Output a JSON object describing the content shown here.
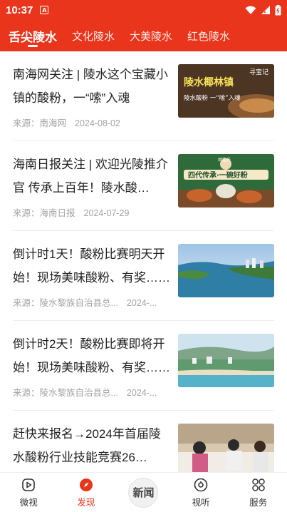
{
  "status": {
    "time": "10:37",
    "notif_letter": "A"
  },
  "tabs": [
    {
      "label": "舌尖陵水"
    },
    {
      "label": "文化陵水"
    },
    {
      "label": "大美陵水"
    },
    {
      "label": "红色陵水"
    }
  ],
  "articles": [
    {
      "title": "南海网关注 | 陵水这个宝藏小镇的酸粉，一“嗦”入魂",
      "source": "来源：南海网",
      "date": "2024-08-02",
      "thumb_text_1": "陵水椰林镇",
      "thumb_text_2": "陵水酸粉 一“嗦”入魂",
      "thumb_text_3": "寻宝记"
    },
    {
      "title": "海南日报关注 | 欢迎光陵推介官 传承上百年！陵水酸粉……",
      "source": "来源：海南日报",
      "date": "2024-07-29",
      "thumb_text_1": "四代传承·一碗好粉",
      "thumb_text_2": "胡佳光"
    },
    {
      "title": "倒计时1天！酸粉比赛明天开始！现场美味酸粉、有奖……",
      "source": "来源：陵水黎族自治县总...",
      "date": "2024-..."
    },
    {
      "title": "倒计时2天！酸粉比赛即将开始！现场美味酸粉、有奖……",
      "source": "来源：陵水黎族自治县总...",
      "date": "2024-..."
    },
    {
      "title": "赶快来报名→2024年首届陵水酸粉行业技能竞赛26日……",
      "source": "",
      "date": ""
    }
  ],
  "bottom_nav": [
    {
      "label": "微视",
      "icon": "play-circle-icon"
    },
    {
      "label": "发现",
      "icon": "compass-icon"
    },
    {
      "label": "新闻",
      "icon": "news-logo-icon"
    },
    {
      "label": "视听",
      "icon": "target-icon"
    },
    {
      "label": "服务",
      "icon": "grid-icon"
    }
  ],
  "colors": {
    "brand": "#e8351b",
    "text": "#222222",
    "meta": "#a4a4a4"
  }
}
